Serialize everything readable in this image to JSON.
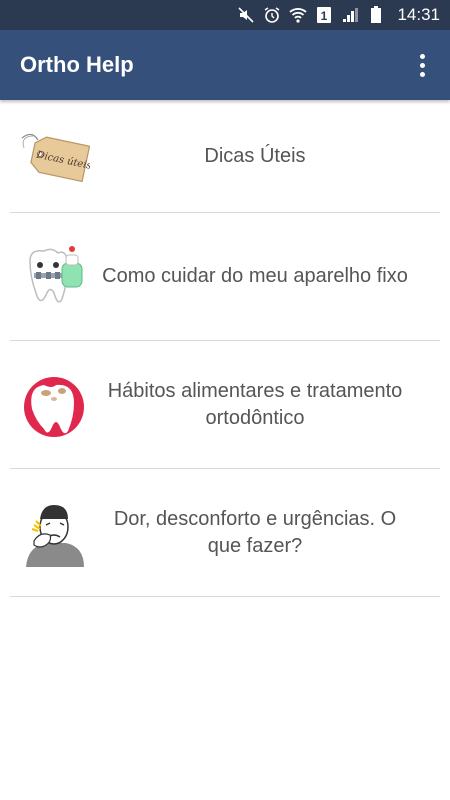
{
  "status_bar": {
    "time": "14:31",
    "icons": [
      "mute-icon",
      "alarm-icon",
      "wifi-icon",
      "sim-1-icon",
      "signal-icon",
      "battery-icon"
    ],
    "sim_label": "1"
  },
  "app_bar": {
    "title": "Ortho Help",
    "background": "#35507b",
    "overflow_icon": "more-vert-icon"
  },
  "menu": {
    "items": [
      {
        "label": "Dicas Úteis",
        "icon": "tag-icon",
        "tag_text": "Dicas úteis"
      },
      {
        "label": "Como cuidar do meu aparelho fixo",
        "icon": "tooth-braces-icon"
      },
      {
        "label": "Hábitos alimentares e tratamento ortodôntico",
        "icon": "tooth-decay-icon"
      },
      {
        "label": "Dor, desconforto e urgências. O que fazer?",
        "icon": "toothache-person-icon"
      }
    ]
  }
}
